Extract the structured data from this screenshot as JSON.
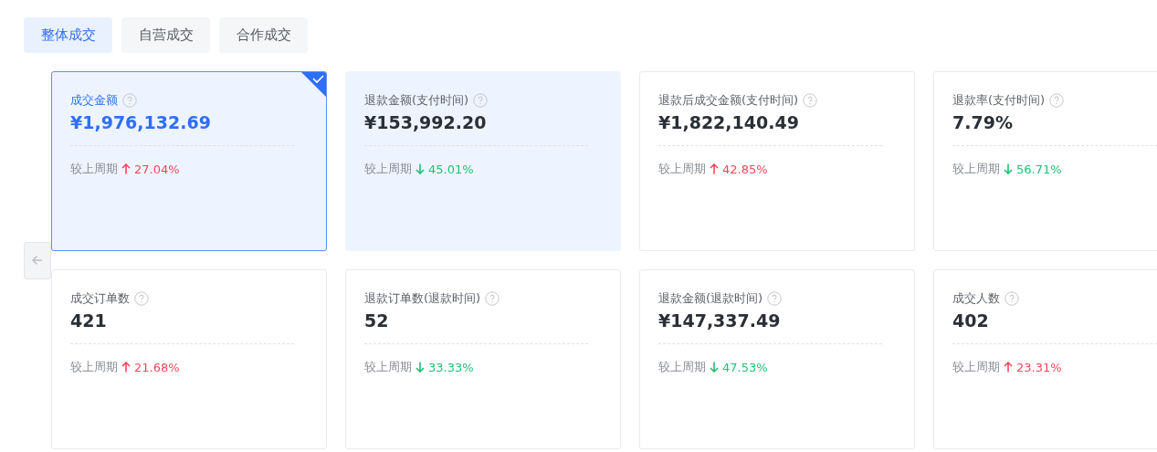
{
  "tabs": [
    {
      "label": "整体成交",
      "selected": true
    },
    {
      "label": "自营成交",
      "selected": false
    },
    {
      "label": "合作成交",
      "selected": false
    }
  ],
  "cards": [
    {
      "title": "成交金额",
      "value": "¥1,976,132.69",
      "compare_label": "较上周期",
      "rising": true,
      "change": "27.04%",
      "selected": true,
      "highlighted": false
    },
    {
      "title": "退款金额(支付时间)",
      "value": "¥153,992.20",
      "compare_label": "较上周期",
      "rising": false,
      "change": "45.01%",
      "selected": false,
      "highlighted": true
    },
    {
      "title": "退款后成交金额(支付时间)",
      "value": "¥1,822,140.49",
      "compare_label": "较上周期",
      "rising": true,
      "change": "42.85%",
      "selected": false,
      "highlighted": false
    },
    {
      "title": "退款率(支付时间)",
      "value": "7.79%",
      "compare_label": "较上周期",
      "rising": false,
      "change": "56.71%",
      "selected": false,
      "highlighted": false
    },
    {
      "title": "成交订单数",
      "value": "421",
      "compare_label": "较上周期",
      "rising": true,
      "change": "21.68%",
      "selected": false,
      "highlighted": false
    },
    {
      "title": "退款订单数(退款时间)",
      "value": "52",
      "compare_label": "较上周期",
      "rising": false,
      "change": "33.33%",
      "selected": false,
      "highlighted": false
    },
    {
      "title": "退款金额(退款时间)",
      "value": "¥147,337.49",
      "compare_label": "较上周期",
      "rising": false,
      "change": "47.53%",
      "selected": false,
      "highlighted": false
    },
    {
      "title": "成交人数",
      "value": "402",
      "compare_label": "较上周期",
      "rising": true,
      "change": "23.31%",
      "selected": false,
      "highlighted": false
    }
  ]
}
